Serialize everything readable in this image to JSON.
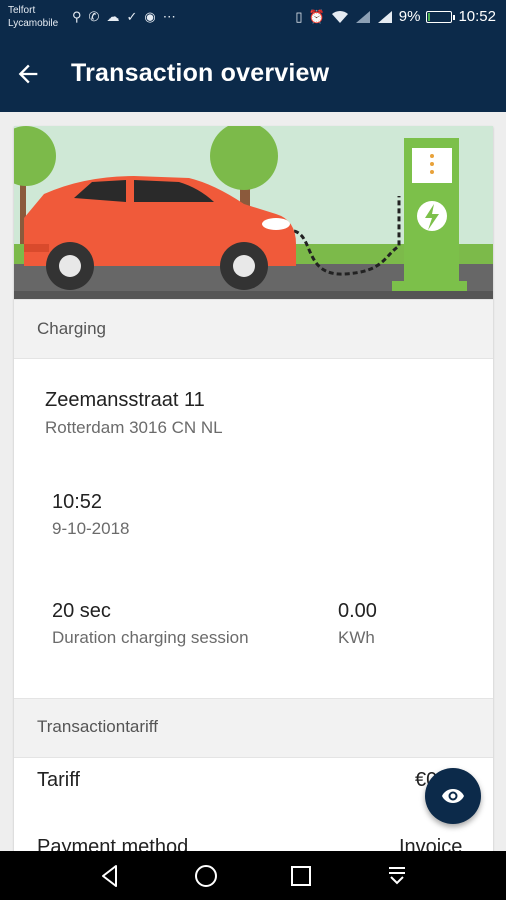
{
  "status_bar": {
    "carrier_line1": "Telfort",
    "carrier_line2": "Lycamobile",
    "left_icons": [
      "usb-icon",
      "wifi-call-icon",
      "cloud-icon",
      "download-done-icon",
      "app-icon",
      "more-icon"
    ],
    "battery_text": "9%",
    "battery_level": 0.09,
    "time": "10:52"
  },
  "app_bar": {
    "title": "Transaction overview"
  },
  "charging": {
    "header": "Charging",
    "address_line1": "Zeemansstraat 11",
    "address_line2": "Rotterdam 3016 CN NL",
    "time": "10:52",
    "date": "9-10-2018",
    "duration_value": "20 sec",
    "duration_label": "Duration charging session",
    "energy_value": "0.00",
    "energy_unit": "KWh"
  },
  "tariff": {
    "header": "Transactiontariff",
    "tariff_label": "Tariff",
    "tariff_value": "€0",
    "payment_label": "Payment method",
    "payment_value": "Invoice"
  },
  "colors": {
    "primary": "#0c2a4a",
    "car": "#f05a3a",
    "charger": "#7cc04a"
  }
}
